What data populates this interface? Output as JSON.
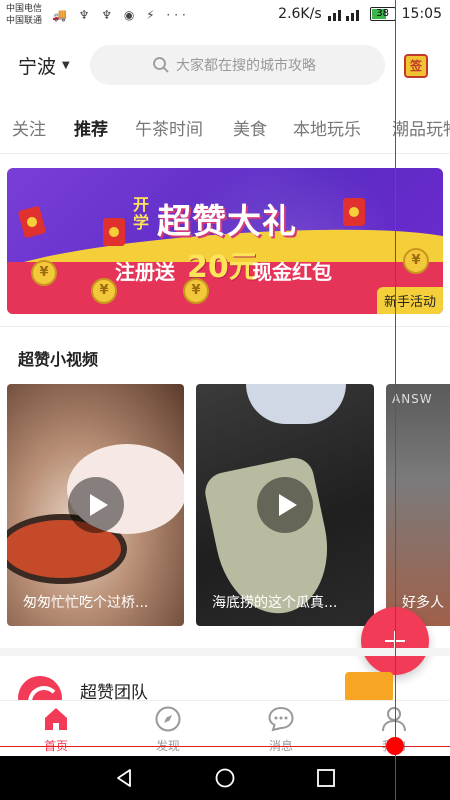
{
  "status_bar": {
    "carrier_1": "中国电信",
    "carrier_2": "中国联通",
    "left_icons": "🚚 ♆ ♆ ◉ ⚡ ···",
    "speed": "2.6K/s",
    "battery": "38",
    "time": "15:05"
  },
  "header": {
    "city": "宁波",
    "search_placeholder": "大家都在搜的城市攻略",
    "checkin_label": "签"
  },
  "tabs": [
    {
      "label": "关注"
    },
    {
      "label": "推荐"
    },
    {
      "label": "午茶时间"
    },
    {
      "label": "美食"
    },
    {
      "label": "本地玩乐"
    },
    {
      "label": "潮品玩物"
    }
  ],
  "banner": {
    "kaixue": "开学",
    "title": "超赞大礼",
    "sub_prefix": "注册送",
    "amount": "20元",
    "sub_suffix": "现金红包",
    "badge": "新手活动",
    "coin_symbol": "¥"
  },
  "section": {
    "title": "超赞小视频"
  },
  "videos": [
    {
      "caption": "匆匆忙忙吃个过桥..."
    },
    {
      "caption": "海底捞的这个瓜真..."
    },
    {
      "caption": "好多人",
      "sign": "ANSW"
    }
  ],
  "team": {
    "name": "超赞团队"
  },
  "bottom_nav": [
    {
      "label": "首页",
      "icon": "home-icon"
    },
    {
      "label": "发现",
      "icon": "compass-icon"
    },
    {
      "label": "消息",
      "icon": "chat-icon"
    },
    {
      "label": "我的",
      "icon": "user-icon"
    }
  ],
  "colors": {
    "accent": "#f23c57",
    "banner_purple": "#6a34cc",
    "banner_yellow": "#f5cf3a"
  }
}
